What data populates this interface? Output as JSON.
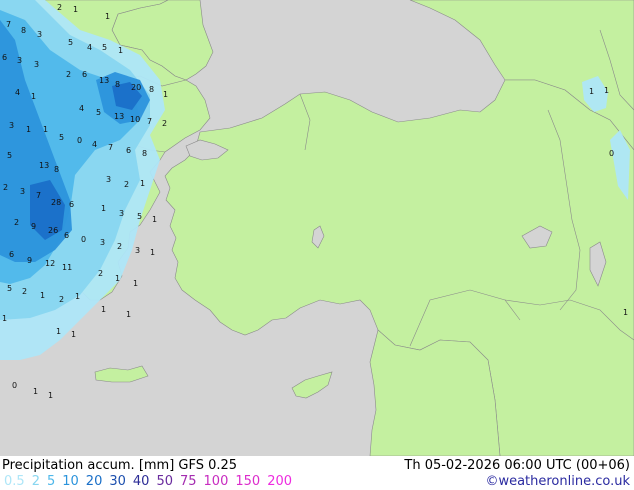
{
  "footer": {
    "title": "Precipitation accum. [mm]  GFS 0.25",
    "datetime": "Th 05-02-2026 06:00 UTC (00+06)",
    "copyright": "©weatheronline.co.uk"
  },
  "legend": [
    {
      "label": "0.5",
      "color": "#aee6f8"
    },
    {
      "label": "2",
      "color": "#88d6f0"
    },
    {
      "label": "5",
      "color": "#4fb8ea"
    },
    {
      "label": "10",
      "color": "#2c94dc"
    },
    {
      "label": "20",
      "color": "#1a6fc8"
    },
    {
      "label": "30",
      "color": "#1c4fae"
    },
    {
      "label": "40",
      "color": "#2c2c96"
    },
    {
      "label": "50",
      "color": "#6a2c9e"
    },
    {
      "label": "75",
      "color": "#a42cb0"
    },
    {
      "label": "100",
      "color": "#c82cc0"
    },
    {
      "label": "150",
      "color": "#dc2ccc"
    },
    {
      "label": "200",
      "color": "#ee2ce0"
    }
  ],
  "colors": {
    "land": "#c4f0a0",
    "sea": "#d4d4d4",
    "border": "#8a8a8a"
  },
  "precip_values": [
    "7",
    "8",
    "3",
    "2",
    "1",
    "1",
    "5",
    "4",
    "5",
    "6",
    "3",
    "3",
    "1",
    "2",
    "6",
    "13",
    "8",
    "20",
    "8",
    "1",
    "4",
    "1",
    "4",
    "5",
    "13",
    "10",
    "7",
    "2",
    "3",
    "1",
    "1",
    "5",
    "0",
    "4",
    "7",
    "6",
    "8",
    "5",
    "13",
    "8",
    "3",
    "2",
    "1",
    "2",
    "3",
    "7",
    "28",
    "6",
    "1",
    "3",
    "5",
    "1",
    "2",
    "9",
    "26",
    "6",
    "0",
    "3",
    "2",
    "3",
    "6",
    "9",
    "12",
    "11",
    "1",
    "2",
    "1",
    "1",
    "5",
    "2",
    "1",
    "2",
    "1",
    "1",
    "1",
    "1",
    "1",
    "1",
    "0",
    "1",
    "1",
    "1",
    "1",
    "0",
    "1"
  ]
}
